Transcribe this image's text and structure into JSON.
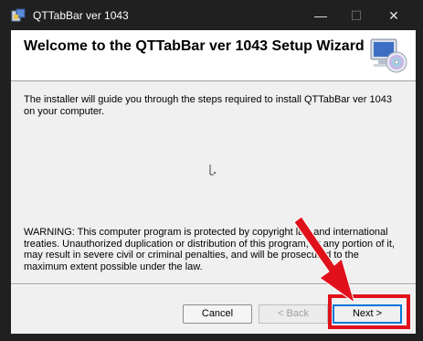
{
  "window": {
    "title": "QTTabBar ver 1043",
    "minimize": "—",
    "maximize": "☐",
    "close": "✕"
  },
  "wizard": {
    "heading": "Welcome to the QTTabBar ver 1043 Setup Wizard",
    "intro": "The installer will guide you through the steps required to install QTTabBar ver 1043 on your computer.",
    "warning": "WARNING: This computer program is protected by copyright law and international treaties. Unauthorized duplication or distribution of this program, or any portion of it, may result in severe civil or criminal penalties, and will be prosecuted to the maximum extent possible under the law."
  },
  "buttons": {
    "cancel": "Cancel",
    "back": "< Back",
    "next": "Next >"
  },
  "annotation": {
    "highlight_color": "#e0111b",
    "arrow_icon": "red-arrow-icon"
  }
}
